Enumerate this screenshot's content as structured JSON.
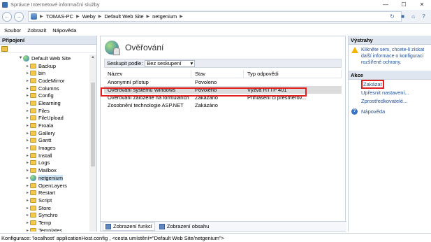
{
  "window": {
    "title": "Správce Internetové informační služby",
    "controls": [
      "minimize",
      "maximize",
      "close"
    ]
  },
  "address": {
    "breadcrumbs": [
      "TOMAS-PC",
      "Weby",
      "Default Web Site",
      "netgenium"
    ]
  },
  "menu": {
    "items": [
      "Soubor",
      "Zobrazit",
      "Nápověda"
    ]
  },
  "connections": {
    "title": "Připojení",
    "root": "Default Web Site",
    "items": [
      "Backup",
      "bin",
      "CodeMirror",
      "Columns",
      "Config",
      "Elearning",
      "Files",
      "FileUpload",
      "Froala",
      "Gallery",
      "Gantt",
      "Images",
      "Install",
      "Logs",
      "Mailbox",
      "netgenium",
      "OpenLayers",
      "Restart",
      "Script",
      "Store",
      "Synchro",
      "Temp",
      "Templates"
    ],
    "selected": "netgenium"
  },
  "main": {
    "title": "Ověřování",
    "group_label": "Seskupit podle:",
    "group_value": "Bez seskupení",
    "columns": [
      "Název",
      "Stav",
      "Typ odpovědi"
    ],
    "rows": [
      {
        "name": "Anonymní přístup",
        "state": "Povoleno",
        "response": ""
      },
      {
        "name": "Ověřování systému Windows",
        "state": "Povoleno",
        "response": "Výzva HTTP 401"
      },
      {
        "name": "Ověřování založené na formulářích",
        "state": "Zakázáno",
        "response": "Přihlášení či přesměrov..."
      },
      {
        "name": "Zosobnění technologie ASP.NET",
        "state": "Zakázáno",
        "response": ""
      }
    ],
    "tabs": [
      "Zobrazení funkcí",
      "Zobrazení obsahu"
    ]
  },
  "actions": {
    "alerts_title": "Výstrahy",
    "alert_text": "Klikněte sem, chcete-li získat další informace o konfiguraci rozšířené ochrany.",
    "actions_title": "Akce",
    "items": [
      "Zakázat",
      "Upřesnit nastavení...",
      "Zprostředkovatelé..."
    ],
    "help": "Nápověda"
  },
  "status": {
    "text": "Konfigurace: 'localhost' applicationHost.config , <cesta umístění=\"Default Web Site/netgenium\">"
  },
  "colors": {
    "highlight": "#e0201f",
    "link": "#1f4e9a",
    "panel_header": "#dfe6ef"
  }
}
